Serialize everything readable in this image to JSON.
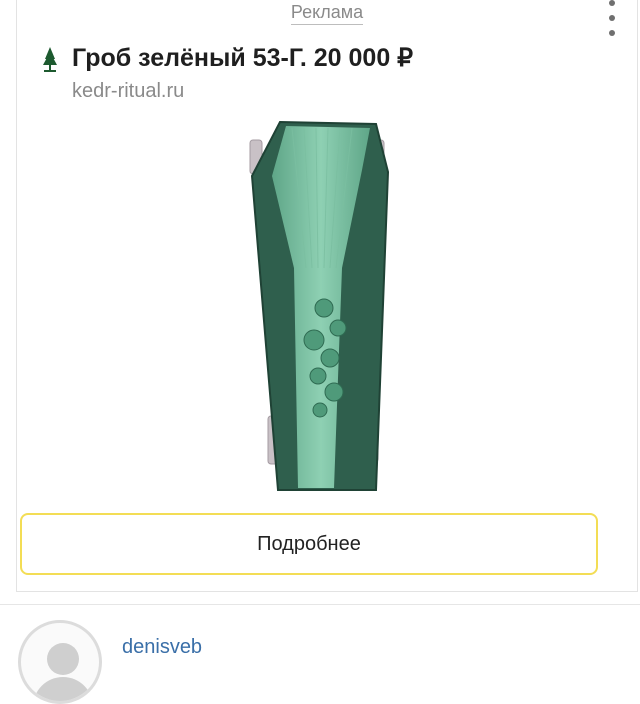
{
  "ad": {
    "label": "Реклама",
    "title": "Гроб зелёный 53-Г. 20 000 ₽",
    "domain": "kedr-ritual.ru",
    "button_label": "Подробнее",
    "image_alt": "coffin-image"
  },
  "icons": {
    "logo": "tree-logo-icon",
    "menu": "more-vertical-icon",
    "avatar": "user-avatar-icon"
  },
  "post": {
    "username": "denisveb"
  },
  "colors": {
    "button_border": "#f3dd55",
    "username": "#3a6fa8",
    "coffin_green": "#3f8a6e"
  }
}
